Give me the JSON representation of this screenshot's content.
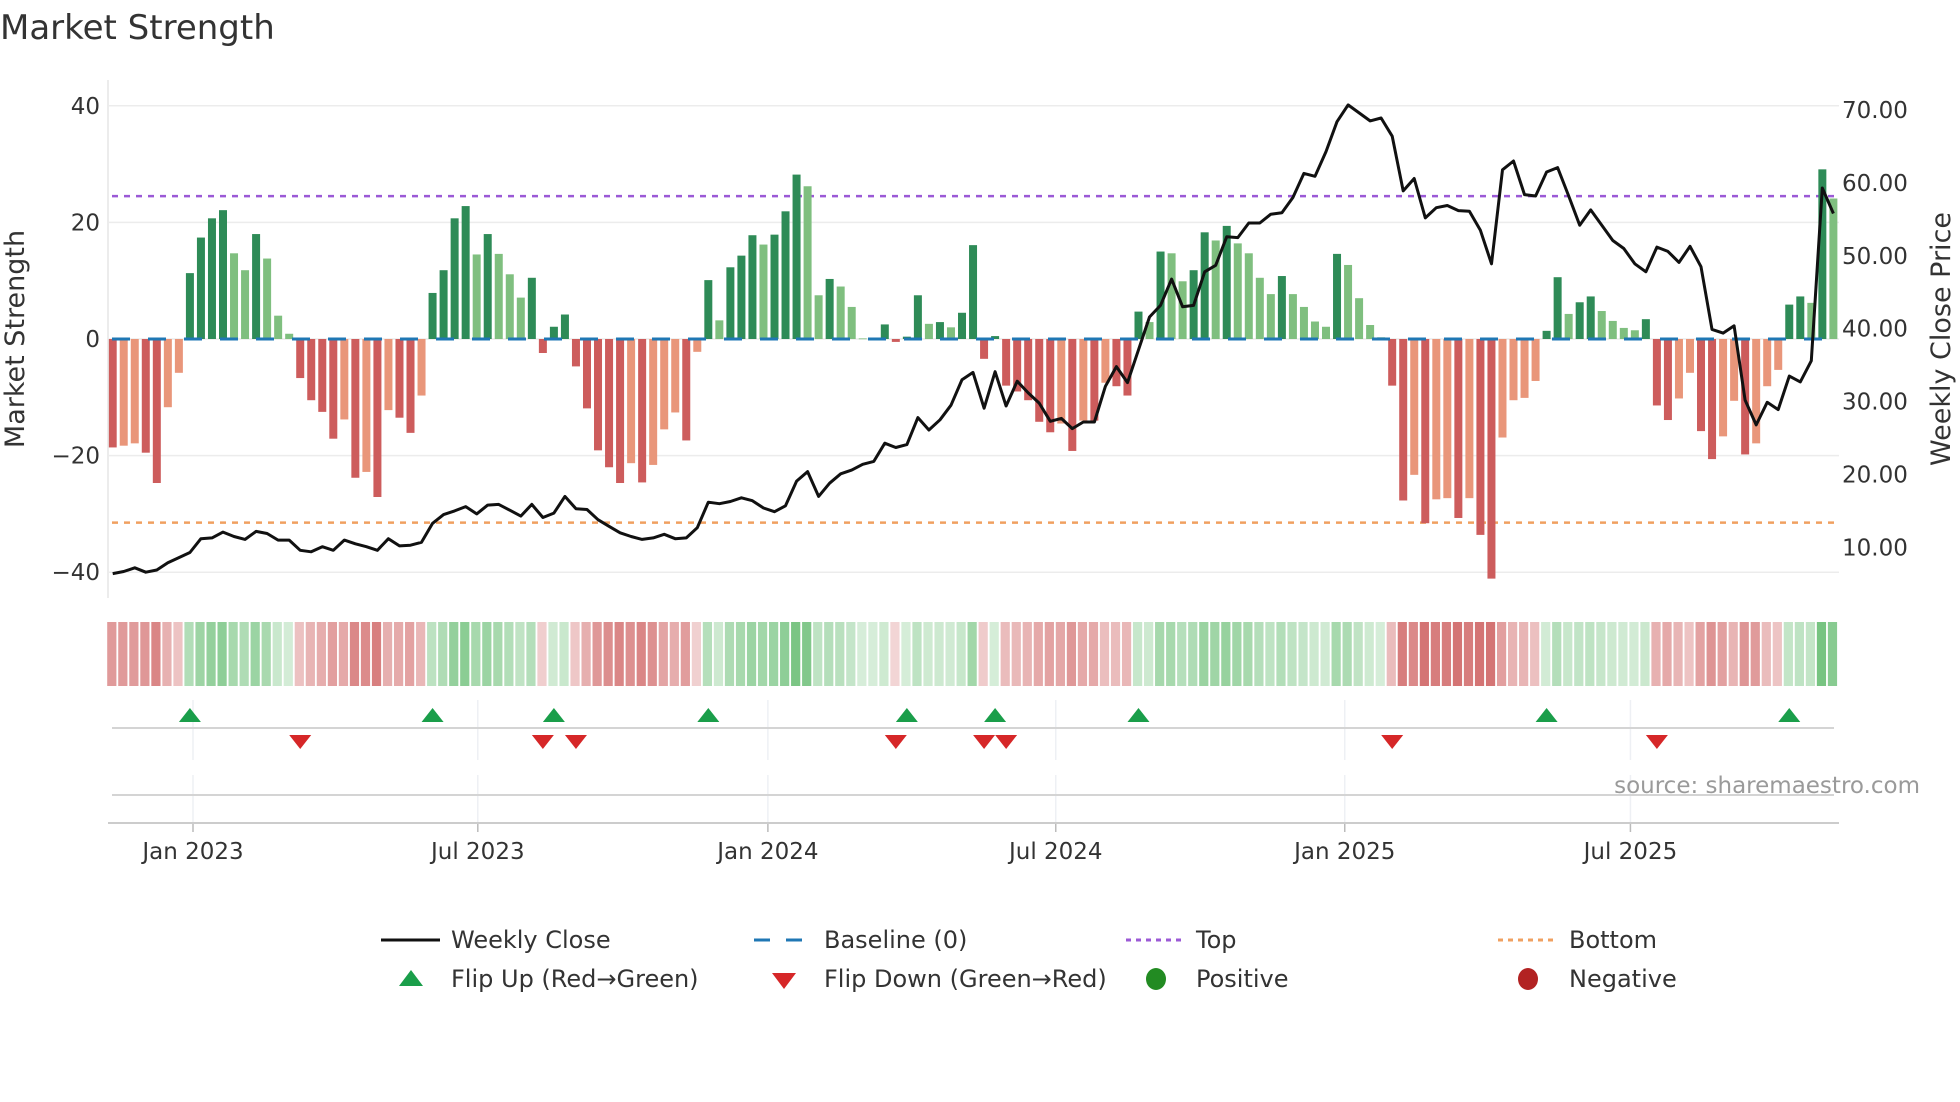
{
  "chart_data": {
    "type": "bar+line",
    "title": "Market Strength",
    "ylabel_left": "Market Strength",
    "ylabel_right": "Weekly Close Price",
    "ylim_left": [
      -40,
      40
    ],
    "yticks_left": [
      "40",
      "20",
      "0",
      "−20",
      "−40"
    ],
    "yticks_left_values": [
      40,
      20,
      0,
      -20,
      -40
    ],
    "ylim_right": [
      10,
      70
    ],
    "yticks_right": [
      "70.00",
      "60.00",
      "50.00",
      "40.00",
      "30.00",
      "20.00",
      "10.00"
    ],
    "yticks_right_values": [
      70,
      60,
      50,
      40,
      30,
      20,
      10
    ],
    "x_ticks": [
      {
        "label": "Jan 2023",
        "week": 7.28
      },
      {
        "label": "Jul 2023",
        "week": 33.1
      },
      {
        "label": "Jan 2024",
        "week": 59.4
      },
      {
        "label": "Jul 2024",
        "week": 85.5
      },
      {
        "label": "Jan 2025",
        "week": 111.7
      },
      {
        "label": "Jul 2025",
        "week": 137.6
      }
    ],
    "top_level": 24.5,
    "bottom_level": -31.5,
    "baseline": 0,
    "strength": [
      -18.6,
      -18.3,
      -17.9,
      -19.5,
      -24.7,
      -11.7,
      -5.8,
      11.3,
      17.4,
      20.7,
      22.1,
      14.7,
      11.8,
      18,
      13.8,
      4,
      0.9,
      -6.7,
      -10.5,
      -12.5,
      -17.1,
      -13.8,
      -23.8,
      -22.8,
      -27.1,
      -12.2,
      -13.5,
      -16.1,
      -9.7,
      7.9,
      11.8,
      20.7,
      22.8,
      14.5,
      18,
      14.6,
      11.1,
      7.1,
      10.5,
      -2.4,
      2.1,
      4.2,
      -4.7,
      -11.9,
      -19.1,
      -22,
      -24.7,
      -21.3,
      -24.6,
      -21.6,
      -15.5,
      -12.6,
      -17.4,
      -2.2,
      10.1,
      3.2,
      12.3,
      14.3,
      17.8,
      16.2,
      17.9,
      21.9,
      28.2,
      26.2,
      7.5,
      10.3,
      9,
      5.5,
      0.1,
      0.05,
      2.5,
      -0.5,
      0.4,
      7.5,
      2.6,
      2.9,
      2,
      4.5,
      16.1,
      -3.4,
      0.5,
      -8,
      -9,
      -10.5,
      -14.2,
      -16,
      -14.5,
      -19.2,
      -14,
      -14,
      -7.5,
      -8.1,
      -9.7,
      4.7,
      2.9,
      15,
      14.7,
      9.9,
      11.8,
      18.3,
      16.9,
      19.4,
      16.4,
      14.7,
      10.5,
      7.7,
      10.8,
      7.7,
      5.5,
      3,
      2.1,
      14.6,
      12.7,
      7,
      2.4,
      0.3,
      -8,
      -27.7,
      -23.3,
      -31.6,
      -27.5,
      -27.3,
      -30.7,
      -27.3,
      -33.6,
      -41.1,
      -16.9,
      -10.5,
      -10.1,
      -7.2,
      1.4,
      10.6,
      4.3,
      6.3,
      7.3,
      4.8,
      3.1,
      1.9,
      1.5,
      3.4,
      -11.4,
      -13.9,
      -10.2,
      -5.8,
      -15.8,
      -20.6,
      -16.7,
      -10.6,
      -19.8,
      -17.9,
      -8.1,
      -5.3,
      5.9,
      7.3,
      6.2,
      29.1,
      24.1
    ],
    "weekly_close": [
      6.4,
      6.7,
      7.2,
      6.6,
      6.9,
      7.9,
      8.6,
      9.3,
      11.2,
      11.3,
      12.1,
      11.5,
      11.1,
      12.2,
      11.9,
      11,
      11,
      9.6,
      9.4,
      10.1,
      9.6,
      11,
      10.5,
      10.1,
      9.6,
      11.2,
      10.2,
      10.3,
      10.7,
      13.3,
      14.5,
      15,
      15.6,
      14.6,
      15.8,
      15.9,
      15.1,
      14.3,
      15.9,
      14.1,
      14.7,
      17,
      15.3,
      15.2,
      13.8,
      12.9,
      12,
      11.5,
      11.1,
      11.3,
      11.8,
      11.2,
      11.3,
      12.7,
      16.2,
      16,
      16.3,
      16.8,
      16.4,
      15.4,
      14.9,
      15.7,
      19.1,
      20.4,
      17,
      18.8,
      20.1,
      20.6,
      21.4,
      21.8,
      24.3,
      23.7,
      24.1,
      27.8,
      26.1,
      27.5,
      29.5,
      33,
      34,
      29.1,
      34.1,
      29.4,
      32.8,
      31.2,
      29.8,
      27.3,
      27.7,
      26.3,
      27.2,
      27.2,
      32.1,
      34.8,
      32.6,
      37.1,
      41.6,
      43.2,
      46.8,
      43,
      43.2,
      47.8,
      48.7,
      52.6,
      52.5,
      54.5,
      54.5,
      55.7,
      55.9,
      58,
      61.3,
      60.9,
      64.3,
      68.4,
      70.7,
      69.6,
      68.5,
      68.9,
      66.4,
      58.9,
      60.6,
      55.2,
      56.6,
      56.9,
      56.2,
      56.1,
      53.5,
      48.9,
      61.8,
      63,
      58.4,
      58.2,
      61.5,
      62.1,
      58.2,
      54.2,
      56.3,
      54.2,
      52.1,
      51,
      48.9,
      47.8,
      51.2,
      50.6,
      49.1,
      51.3,
      48.5,
      39.9,
      39.4,
      40.4,
      30.2,
      26.8,
      29.9,
      28.9,
      33.5,
      32.7,
      35.6,
      59.3,
      55.8
    ],
    "flip_up_weeks": [
      7,
      29,
      40,
      54,
      72,
      80,
      93,
      130,
      152
    ],
    "flip_down_weeks": [
      17,
      39,
      42,
      71,
      79,
      81,
      116,
      140
    ],
    "colors": {
      "pos_strong": "#2e8b57",
      "pos_weak": "#7fbf7f",
      "neg_strong": "#cd5c5c",
      "neg_weak": "#e9967a",
      "line": "#111111",
      "baseline": "#1f77b4",
      "top": "#9b59d6",
      "bottom": "#f0a060",
      "flip_up": "#1a9e4a",
      "flip_down": "#d62728",
      "positive": "#228b22",
      "negative": "#b22222"
    },
    "legend": {
      "placement": "bottom",
      "items": [
        "Weekly Close",
        "Baseline (0)",
        "Top",
        "Bottom",
        "Flip Up (Red→Green)",
        "Flip Down (Green→Red)",
        "Positive",
        "Negative"
      ]
    },
    "source": "source: sharemaestro.com"
  }
}
